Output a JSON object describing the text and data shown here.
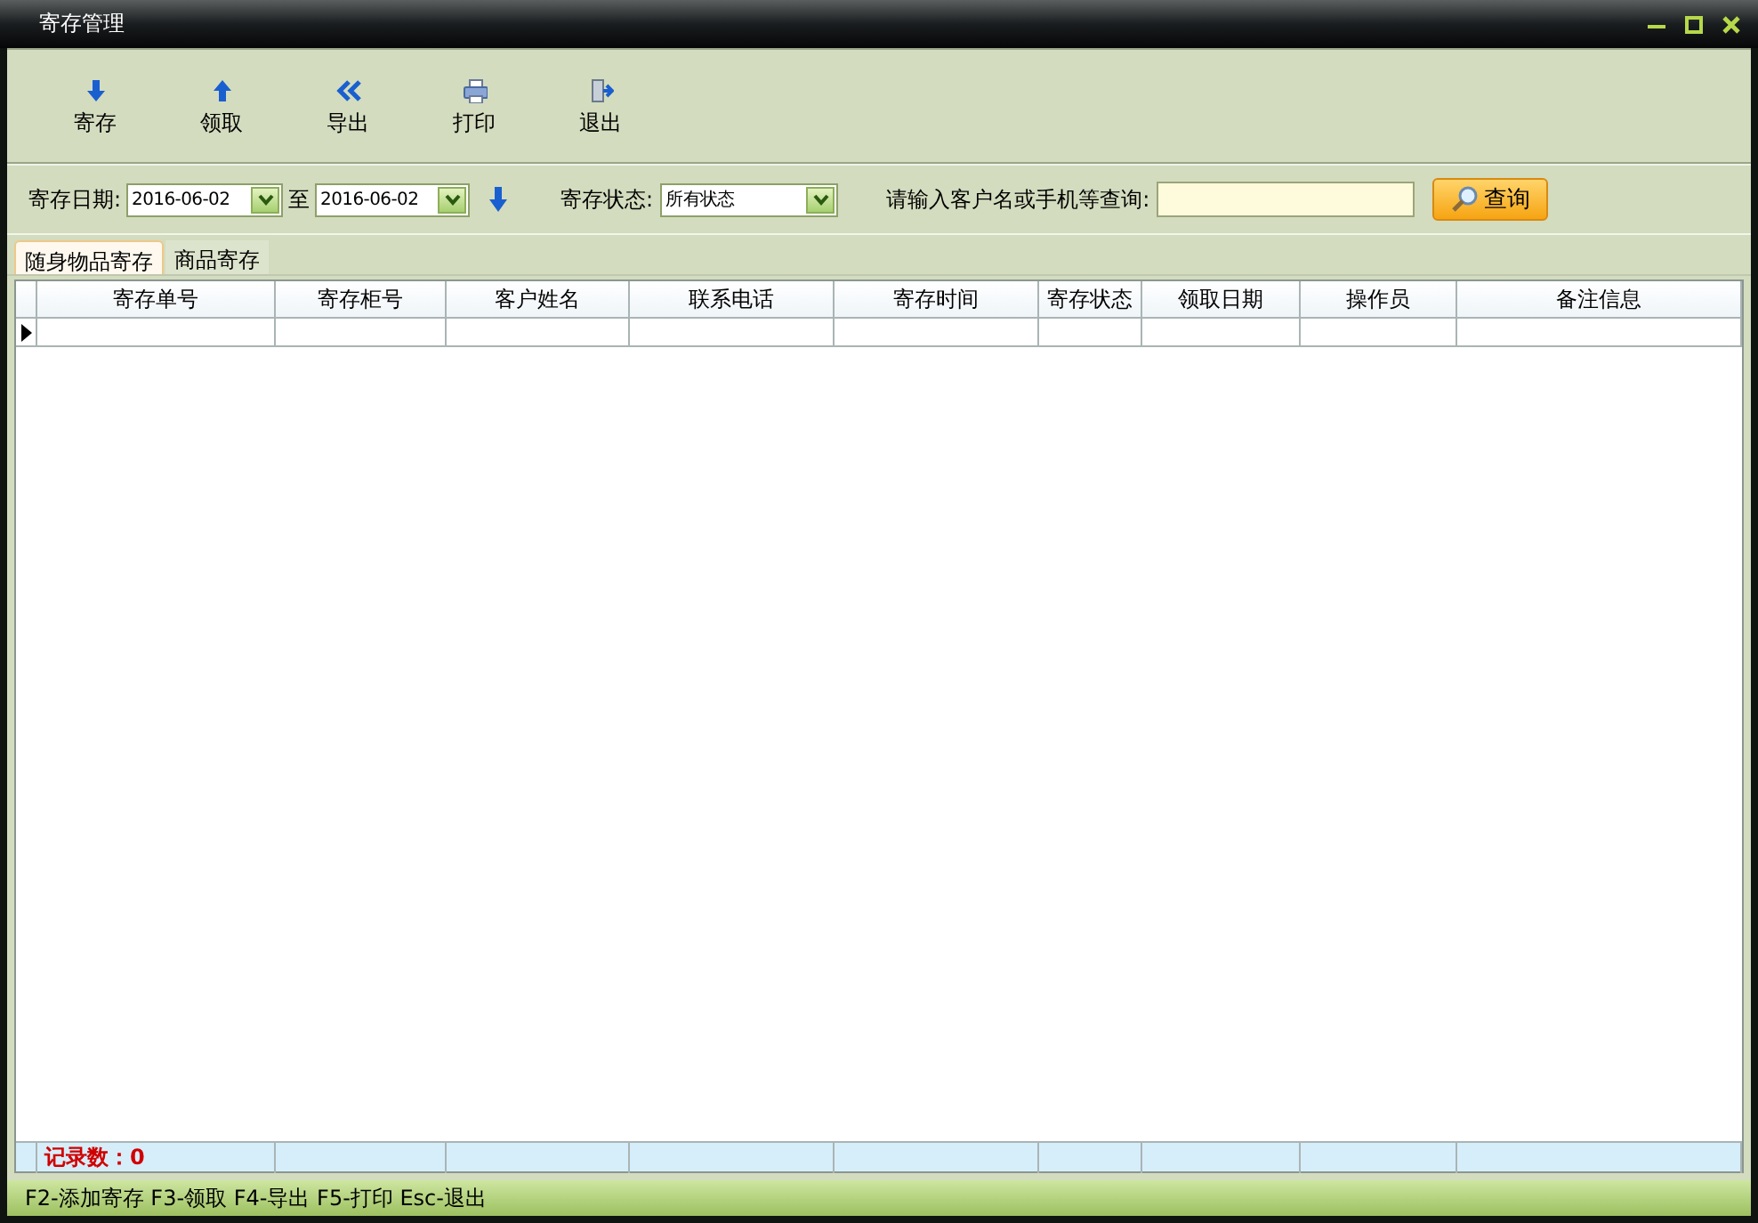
{
  "window": {
    "title": "寄存管理"
  },
  "toolbar": {
    "buttons": [
      {
        "label": "寄存"
      },
      {
        "label": "领取"
      },
      {
        "label": "导出"
      },
      {
        "label": "打印"
      },
      {
        "label": "退出"
      }
    ]
  },
  "filter": {
    "date_label": "寄存日期:",
    "date_from": "2016-06-02",
    "date_separator": "至",
    "date_to": "2016-06-02",
    "status_label": "寄存状态:",
    "status_value": "所有状态",
    "search_label": "请输入客户名或手机等查询:",
    "search_button": "查询"
  },
  "tabs": [
    {
      "label": "随身物品寄存",
      "selected": true
    },
    {
      "label": "商品寄存",
      "selected": false
    }
  ],
  "table": {
    "columns": [
      "寄存单号",
      "寄存柜号",
      "客户姓名",
      "联系电话",
      "寄存时间",
      "寄存状态",
      "领取日期",
      "操作员",
      "备注信息"
    ],
    "rows": [
      {
        "selected": true
      }
    ],
    "footer": "记录数：0"
  },
  "status_bar": "F2-添加寄存 F3-领取 F4-导出 F5-打印 Esc-退出"
}
